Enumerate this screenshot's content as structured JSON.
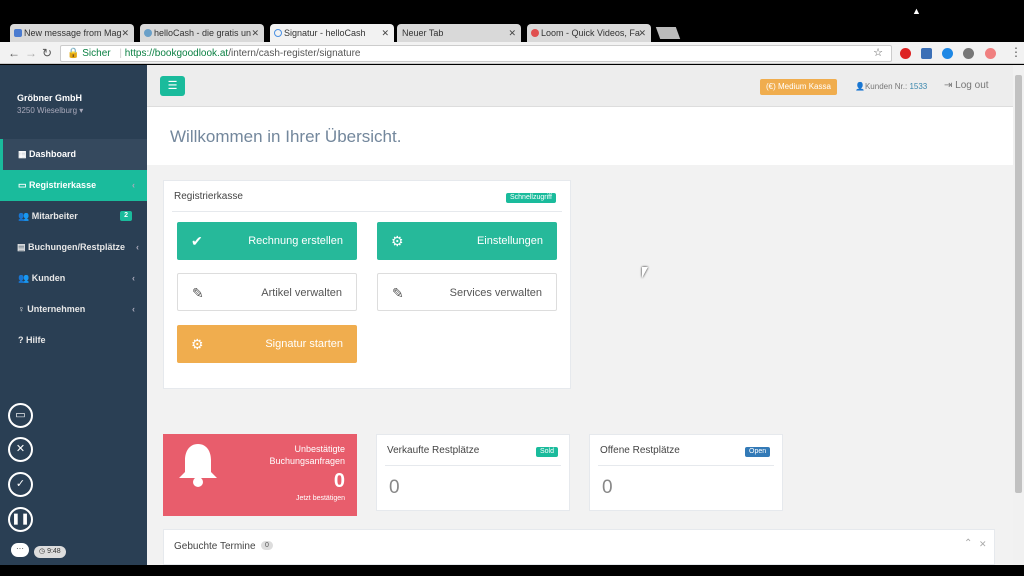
{
  "browser": {
    "tabs": [
      {
        "title": "New message from Mag",
        "color": "#4a7bd0"
      },
      {
        "title": "helloCash - die gratis un",
        "color": "#6aa0c8"
      },
      {
        "title": "Signatur - helloCash",
        "color": "#4a90e2"
      },
      {
        "title": "Neuer Tab",
        "color": ""
      },
      {
        "title": "Loom - Quick Videos, Fa",
        "color": "#e05050"
      }
    ],
    "secure_label": "Sicher",
    "url_host": "https://bookgoodlook.at",
    "url_path": "/intern/cash-register/signature"
  },
  "sidebar": {
    "company": "Gröbner GmbH",
    "location": "3250 Wieselburg",
    "items": [
      {
        "label": "Dashboard",
        "icon": "dashboard-icon"
      },
      {
        "label": "Registrierkasse",
        "icon": "cash-register-icon"
      },
      {
        "label": "Mitarbeiter",
        "icon": "users-icon",
        "badge": "2"
      },
      {
        "label": "Buchungen/Restplätze",
        "icon": "calendar-icon"
      },
      {
        "label": "Kunden",
        "icon": "users-icon"
      },
      {
        "label": "Unternehmen",
        "icon": "lightbulb-icon"
      },
      {
        "label": "Hilfe",
        "icon": "question-icon"
      }
    ]
  },
  "topnav": {
    "kasse_label": "Medium Kassa",
    "kunden_label": "Kunden Nr.:",
    "kunden_number": "1533",
    "logout_label": "Log out"
  },
  "page": {
    "title": "Willkommen in Ihrer Übersicht."
  },
  "register_panel": {
    "title": "Registrierkasse",
    "badge": "Schnellzugriff",
    "buttons": {
      "invoice": "Rechnung erstellen",
      "settings": "Einstellungen",
      "articles": "Artikel verwalten",
      "services": "Services verwalten",
      "signature": "Signatur starten"
    }
  },
  "stats": {
    "unconfirmed_line1": "Unbestätigte",
    "unconfirmed_line2": "Buchungsanfragen",
    "unconfirmed_count": "0",
    "unconfirmed_link": "Jetzt bestätigen",
    "sold_title": "Verkaufte Restplätze",
    "sold_badge": "Sold",
    "sold_count": "0",
    "open_title": "Offene Restplätze",
    "open_badge": "Open",
    "open_count": "0"
  },
  "booked": {
    "title": "Gebuchte Termine",
    "count": "0"
  },
  "loom": {
    "time": "9:48"
  },
  "colors": {
    "sidebar": "#2a3f54",
    "accent": "#1abb9c",
    "orange": "#f0ad4e",
    "red": "#e85d6c",
    "blue": "#337ab7"
  }
}
